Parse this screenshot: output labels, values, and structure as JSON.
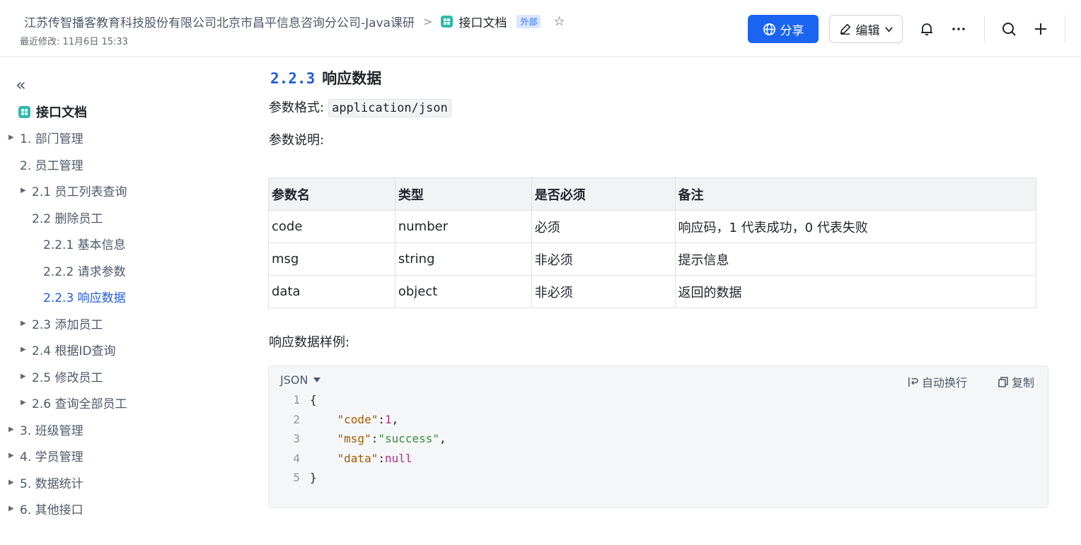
{
  "header": {
    "breadcrumb_parent": "江苏传智播客教育科技股份有限公司北京市昌平信息咨询分公司-Java课研",
    "breadcrumb_separator": ">",
    "doc_title": "接口文档",
    "external_badge": "外部",
    "last_modified": "最近修改: 11月6日 15:33",
    "share_label": "分享",
    "edit_label": "编辑",
    "icons": [
      "globe-icon",
      "pencil-icon",
      "chevron-down-icon",
      "bell-icon",
      "more-icon",
      "search-icon",
      "plus-icon",
      "star-icon"
    ],
    "colors": {
      "primary": "#1a64f0",
      "accent": "#245bdb"
    }
  },
  "sidebar": {
    "root": "接口文档",
    "items": [
      {
        "label": "1. 部门管理",
        "arrow": "▶"
      },
      {
        "label": "2. 员工管理",
        "arrow": ""
      },
      {
        "label": "2.1 员工列表查询",
        "arrow": "▶"
      },
      {
        "label": "2.2 删除员工",
        "arrow": ""
      },
      {
        "label": "2.2.1 基本信息",
        "arrow": ""
      },
      {
        "label": "2.2.2 请求参数",
        "arrow": ""
      },
      {
        "label": "2.2.3 响应数据",
        "arrow": "",
        "active": true
      },
      {
        "label": "2.3 添加员工",
        "arrow": "▶"
      },
      {
        "label": "2.4 根据ID查询",
        "arrow": "▶"
      },
      {
        "label": "2.5 修改员工",
        "arrow": "▶"
      },
      {
        "label": "2.6 查询全部员工",
        "arrow": "▶"
      },
      {
        "label": "3. 班级管理",
        "arrow": "▶"
      },
      {
        "label": "4. 学员管理",
        "arrow": "▶"
      },
      {
        "label": "5. 数据统计",
        "arrow": "▶"
      },
      {
        "label": "6. 其他接口",
        "arrow": "▶"
      }
    ]
  },
  "main": {
    "heading_number": "2.2.3",
    "heading_text": "响应数据",
    "format_label": "参数格式:",
    "format_value": "application/json",
    "desc_label": "参数说明:",
    "table": {
      "headers": [
        "参数名",
        "类型",
        "是否必须",
        "备注"
      ],
      "rows": [
        [
          "code",
          "number",
          "必须",
          "响应码，1 代表成功，0 代表失败"
        ],
        [
          "msg",
          "string",
          "非必须",
          "提示信息"
        ],
        [
          "data",
          "object",
          "非必须",
          "返回的数据"
        ]
      ]
    },
    "example_label": "响应数据样例:",
    "code": {
      "language": "JSON",
      "wrap_label": "自动换行",
      "copy_label": "复制",
      "line_numbers": [
        "1",
        "2",
        "3",
        "4",
        "5"
      ],
      "lines": {
        "l1": "{",
        "l2_key": "\"code\"",
        "l2_colon": ":",
        "l2_val": "1",
        "l2_end": ",",
        "l3_key": "\"msg\"",
        "l3_colon": ":",
        "l3_val": "\"success\"",
        "l3_end": ",",
        "l4_key": "\"data\"",
        "l4_colon": ":",
        "l4_val": "null",
        "l5": "}"
      }
    }
  }
}
